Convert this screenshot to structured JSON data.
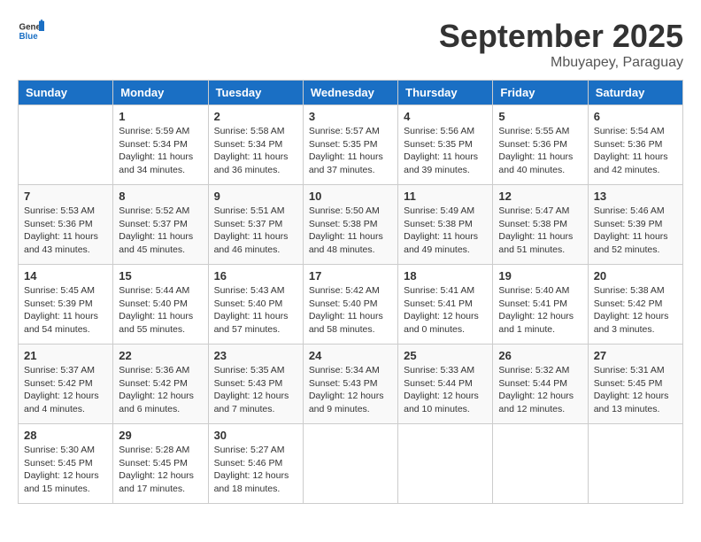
{
  "header": {
    "logo_general": "General",
    "logo_blue": "Blue",
    "month_title": "September 2025",
    "subtitle": "Mbuyapey, Paraguay"
  },
  "days_of_week": [
    "Sunday",
    "Monday",
    "Tuesday",
    "Wednesday",
    "Thursday",
    "Friday",
    "Saturday"
  ],
  "weeks": [
    [
      {
        "day": "",
        "sunrise": "",
        "sunset": "",
        "daylight": ""
      },
      {
        "day": "1",
        "sunrise": "Sunrise: 5:59 AM",
        "sunset": "Sunset: 5:34 PM",
        "daylight": "Daylight: 11 hours and 34 minutes."
      },
      {
        "day": "2",
        "sunrise": "Sunrise: 5:58 AM",
        "sunset": "Sunset: 5:34 PM",
        "daylight": "Daylight: 11 hours and 36 minutes."
      },
      {
        "day": "3",
        "sunrise": "Sunrise: 5:57 AM",
        "sunset": "Sunset: 5:35 PM",
        "daylight": "Daylight: 11 hours and 37 minutes."
      },
      {
        "day": "4",
        "sunrise": "Sunrise: 5:56 AM",
        "sunset": "Sunset: 5:35 PM",
        "daylight": "Daylight: 11 hours and 39 minutes."
      },
      {
        "day": "5",
        "sunrise": "Sunrise: 5:55 AM",
        "sunset": "Sunset: 5:36 PM",
        "daylight": "Daylight: 11 hours and 40 minutes."
      },
      {
        "day": "6",
        "sunrise": "Sunrise: 5:54 AM",
        "sunset": "Sunset: 5:36 PM",
        "daylight": "Daylight: 11 hours and 42 minutes."
      }
    ],
    [
      {
        "day": "7",
        "sunrise": "Sunrise: 5:53 AM",
        "sunset": "Sunset: 5:36 PM",
        "daylight": "Daylight: 11 hours and 43 minutes."
      },
      {
        "day": "8",
        "sunrise": "Sunrise: 5:52 AM",
        "sunset": "Sunset: 5:37 PM",
        "daylight": "Daylight: 11 hours and 45 minutes."
      },
      {
        "day": "9",
        "sunrise": "Sunrise: 5:51 AM",
        "sunset": "Sunset: 5:37 PM",
        "daylight": "Daylight: 11 hours and 46 minutes."
      },
      {
        "day": "10",
        "sunrise": "Sunrise: 5:50 AM",
        "sunset": "Sunset: 5:38 PM",
        "daylight": "Daylight: 11 hours and 48 minutes."
      },
      {
        "day": "11",
        "sunrise": "Sunrise: 5:49 AM",
        "sunset": "Sunset: 5:38 PM",
        "daylight": "Daylight: 11 hours and 49 minutes."
      },
      {
        "day": "12",
        "sunrise": "Sunrise: 5:47 AM",
        "sunset": "Sunset: 5:38 PM",
        "daylight": "Daylight: 11 hours and 51 minutes."
      },
      {
        "day": "13",
        "sunrise": "Sunrise: 5:46 AM",
        "sunset": "Sunset: 5:39 PM",
        "daylight": "Daylight: 11 hours and 52 minutes."
      }
    ],
    [
      {
        "day": "14",
        "sunrise": "Sunrise: 5:45 AM",
        "sunset": "Sunset: 5:39 PM",
        "daylight": "Daylight: 11 hours and 54 minutes."
      },
      {
        "day": "15",
        "sunrise": "Sunrise: 5:44 AM",
        "sunset": "Sunset: 5:40 PM",
        "daylight": "Daylight: 11 hours and 55 minutes."
      },
      {
        "day": "16",
        "sunrise": "Sunrise: 5:43 AM",
        "sunset": "Sunset: 5:40 PM",
        "daylight": "Daylight: 11 hours and 57 minutes."
      },
      {
        "day": "17",
        "sunrise": "Sunrise: 5:42 AM",
        "sunset": "Sunset: 5:40 PM",
        "daylight": "Daylight: 11 hours and 58 minutes."
      },
      {
        "day": "18",
        "sunrise": "Sunrise: 5:41 AM",
        "sunset": "Sunset: 5:41 PM",
        "daylight": "Daylight: 12 hours and 0 minutes."
      },
      {
        "day": "19",
        "sunrise": "Sunrise: 5:40 AM",
        "sunset": "Sunset: 5:41 PM",
        "daylight": "Daylight: 12 hours and 1 minute."
      },
      {
        "day": "20",
        "sunrise": "Sunrise: 5:38 AM",
        "sunset": "Sunset: 5:42 PM",
        "daylight": "Daylight: 12 hours and 3 minutes."
      }
    ],
    [
      {
        "day": "21",
        "sunrise": "Sunrise: 5:37 AM",
        "sunset": "Sunset: 5:42 PM",
        "daylight": "Daylight: 12 hours and 4 minutes."
      },
      {
        "day": "22",
        "sunrise": "Sunrise: 5:36 AM",
        "sunset": "Sunset: 5:42 PM",
        "daylight": "Daylight: 12 hours and 6 minutes."
      },
      {
        "day": "23",
        "sunrise": "Sunrise: 5:35 AM",
        "sunset": "Sunset: 5:43 PM",
        "daylight": "Daylight: 12 hours and 7 minutes."
      },
      {
        "day": "24",
        "sunrise": "Sunrise: 5:34 AM",
        "sunset": "Sunset: 5:43 PM",
        "daylight": "Daylight: 12 hours and 9 minutes."
      },
      {
        "day": "25",
        "sunrise": "Sunrise: 5:33 AM",
        "sunset": "Sunset: 5:44 PM",
        "daylight": "Daylight: 12 hours and 10 minutes."
      },
      {
        "day": "26",
        "sunrise": "Sunrise: 5:32 AM",
        "sunset": "Sunset: 5:44 PM",
        "daylight": "Daylight: 12 hours and 12 minutes."
      },
      {
        "day": "27",
        "sunrise": "Sunrise: 5:31 AM",
        "sunset": "Sunset: 5:45 PM",
        "daylight": "Daylight: 12 hours and 13 minutes."
      }
    ],
    [
      {
        "day": "28",
        "sunrise": "Sunrise: 5:30 AM",
        "sunset": "Sunset: 5:45 PM",
        "daylight": "Daylight: 12 hours and 15 minutes."
      },
      {
        "day": "29",
        "sunrise": "Sunrise: 5:28 AM",
        "sunset": "Sunset: 5:45 PM",
        "daylight": "Daylight: 12 hours and 17 minutes."
      },
      {
        "day": "30",
        "sunrise": "Sunrise: 5:27 AM",
        "sunset": "Sunset: 5:46 PM",
        "daylight": "Daylight: 12 hours and 18 minutes."
      },
      {
        "day": "",
        "sunrise": "",
        "sunset": "",
        "daylight": ""
      },
      {
        "day": "",
        "sunrise": "",
        "sunset": "",
        "daylight": ""
      },
      {
        "day": "",
        "sunrise": "",
        "sunset": "",
        "daylight": ""
      },
      {
        "day": "",
        "sunrise": "",
        "sunset": "",
        "daylight": ""
      }
    ]
  ]
}
